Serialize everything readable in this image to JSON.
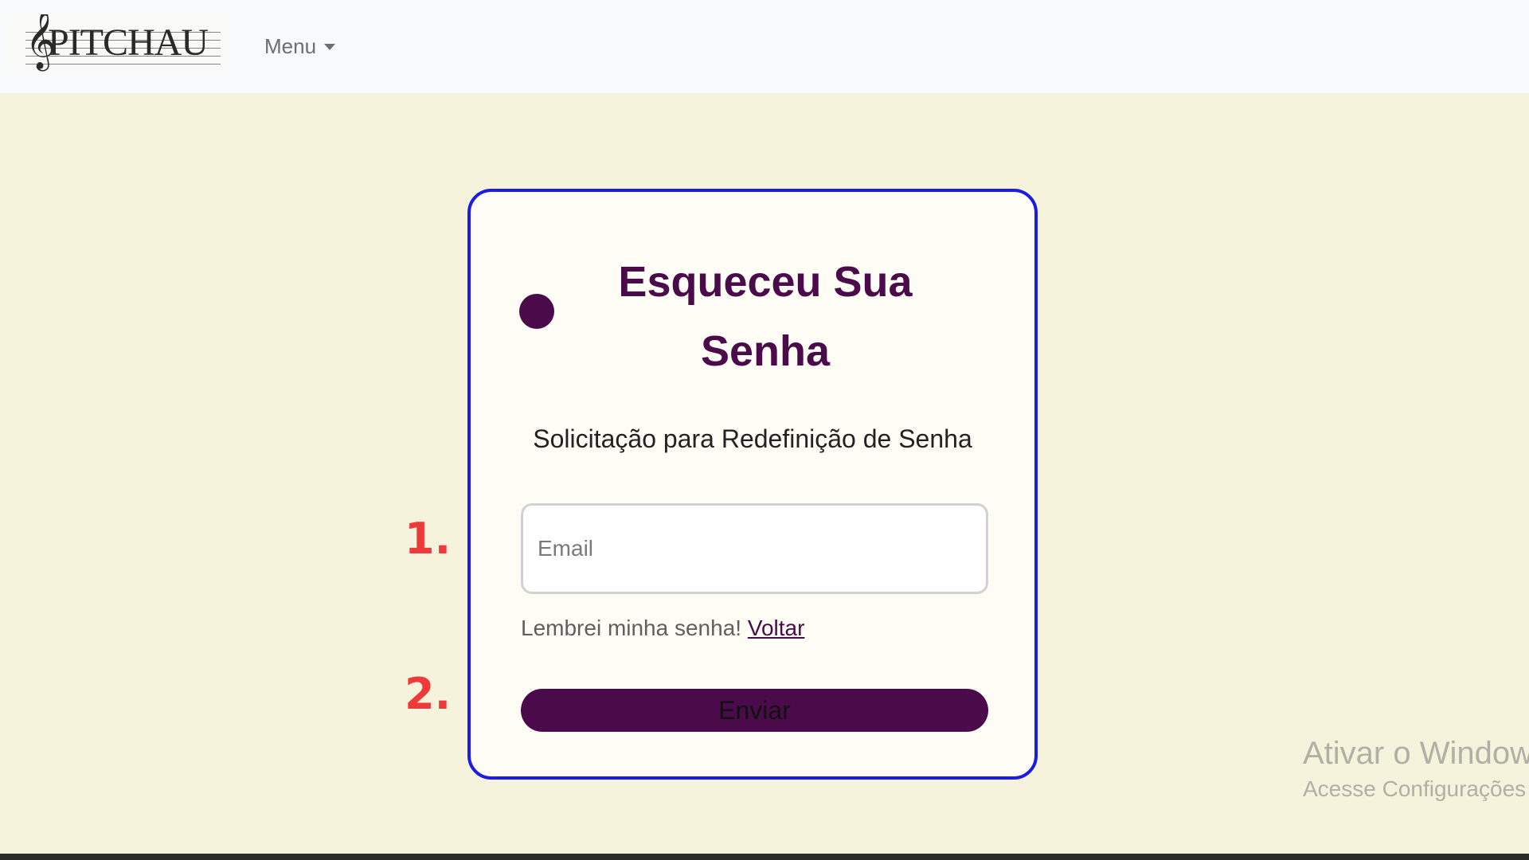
{
  "navbar": {
    "logo_text": "PITCHAU",
    "logo_clef": "𝄞",
    "menu_label": "Menu"
  },
  "card": {
    "title": "Esqueceu Sua Senha",
    "subtitle": "Solicitação para Redefinição de Senha",
    "email_placeholder": "Email",
    "helper_text": "Lembrei minha senha!",
    "helper_link": "Voltar",
    "submit_label": "Enviar"
  },
  "annotations": {
    "step1": "1.",
    "step2": "2."
  },
  "watermark": {
    "title": "Ativar o Windows",
    "subtitle": "Acesse Configurações"
  },
  "colors": {
    "brand_purple": "#4B0A4A",
    "card_border": "#1C1CE6",
    "page_background": "#F5F3DC",
    "annotation_red": "#EE3A3A"
  },
  "icons": {
    "menu_caret": "chevron-down-icon",
    "decor_dot": "dot-icon"
  }
}
